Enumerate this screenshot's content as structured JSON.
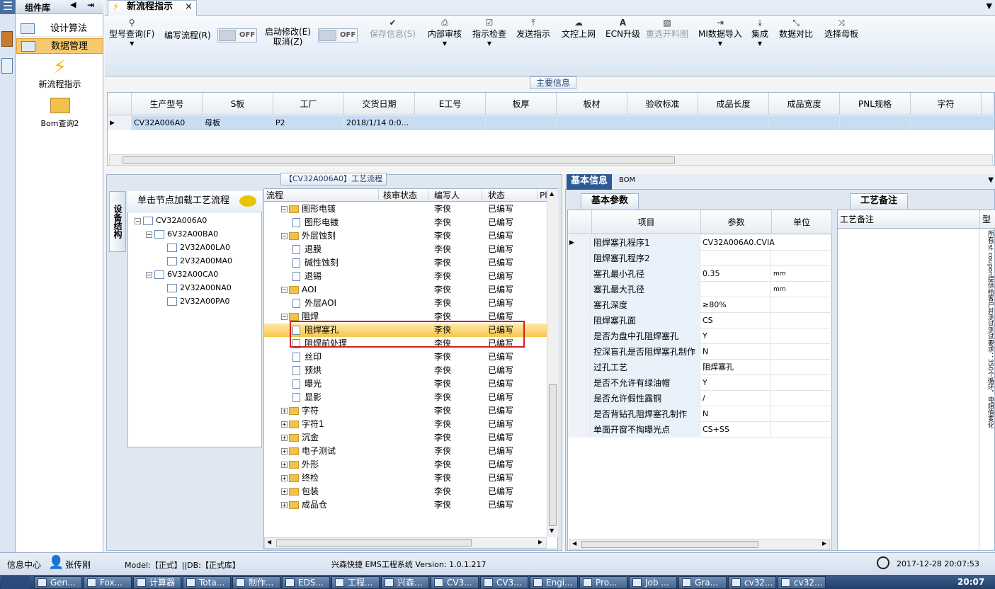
{
  "sidebar": {
    "title": "组件库",
    "items": [
      {
        "label": "设计算法"
      },
      {
        "label": "数据管理",
        "selected": true
      }
    ],
    "tools": [
      {
        "label": "新流程指示",
        "icon": "lightning-icon"
      },
      {
        "label": "Bom查询2",
        "icon": "folder-open-icon"
      }
    ]
  },
  "tab": {
    "title": "新流程指示",
    "close": "×"
  },
  "ribbon": {
    "buttons": [
      {
        "label": "型号查询(F)",
        "icon": "search-icon",
        "dropdown": true
      },
      {
        "label": "编写流程(R)"
      },
      {
        "label": "启动修改(E)"
      },
      {
        "label": "取消(Z)"
      },
      {
        "label": "保存信息(S)",
        "icon": "check-icon",
        "disabled": true
      },
      {
        "label": "内部审核",
        "icon": "print-icon",
        "dropdown": true
      },
      {
        "label": "指示检查",
        "icon": "checkbox-icon",
        "dropdown": true
      },
      {
        "label": "发送指示",
        "icon": "upload-icon"
      },
      {
        "label": "文控上网",
        "icon": "cloud-upload-icon"
      },
      {
        "label": "ECN升级",
        "icon": "ecn-icon"
      },
      {
        "label": "重选开料图",
        "icon": "image-icon",
        "disabled": true
      },
      {
        "label": "MI数据导入",
        "icon": "import-icon",
        "dropdown": true
      },
      {
        "label": "集成",
        "icon": "download-icon",
        "dropdown": true
      },
      {
        "label": "数据对比",
        "icon": "compare-icon"
      },
      {
        "label": "选择母板",
        "icon": "shuffle-icon"
      }
    ],
    "toggles": [
      {
        "value": "OFF"
      },
      {
        "value": "OFF"
      }
    ]
  },
  "main_info": {
    "title": "主要信息",
    "columns": [
      "生产型号",
      "S板",
      "工厂",
      "交货日期",
      "E工号",
      "板厚",
      "板材",
      "验收标准",
      "成品长度",
      "成品宽度",
      "PNL规格",
      "字符"
    ],
    "rows": [
      [
        "CV32A006A0",
        "母板",
        "P2",
        "2018/1/14 0:0...",
        "",
        "",
        "",
        "",
        "",
        "",
        "",
        ""
      ]
    ]
  },
  "process": {
    "title": "【CV32A006A0】工艺流程",
    "vertical_tab": "设备结构",
    "tree_header": "单击节点加载工艺流程",
    "tree": [
      {
        "label": "CV32A006A0",
        "level": 0
      },
      {
        "label": "6V32A00BA0",
        "level": 1
      },
      {
        "label": "2V32A00LA0",
        "level": 2
      },
      {
        "label": "2V32A00MA0",
        "level": 2
      },
      {
        "label": "6V32A00CA0",
        "level": 1
      },
      {
        "label": "2V32A00NA0",
        "level": 2
      },
      {
        "label": "2V32A00PA0",
        "level": 2
      }
    ],
    "columns": [
      "流程",
      "核审状态",
      "编写人",
      "状态",
      "Pl"
    ],
    "rows": [
      {
        "name": "图形电镀",
        "kind": "folder",
        "author": "李侠",
        "status": "已编写"
      },
      {
        "name": "图形电镀",
        "kind": "doc",
        "author": "李侠",
        "status": "已编写"
      },
      {
        "name": "外层蚀刻",
        "kind": "folder",
        "author": "李侠",
        "status": "已编写"
      },
      {
        "name": "退膜",
        "kind": "doc",
        "author": "李侠",
        "status": "已编写"
      },
      {
        "name": "碱性蚀刻",
        "kind": "doc",
        "author": "李侠",
        "status": "已编写"
      },
      {
        "name": "退锡",
        "kind": "doc",
        "author": "李侠",
        "status": "已编写"
      },
      {
        "name": "AOI",
        "kind": "folder",
        "author": "李侠",
        "status": "已编写"
      },
      {
        "name": "外层AOI",
        "kind": "doc",
        "author": "李侠",
        "status": "已编写"
      },
      {
        "name": "阻焊",
        "kind": "folder",
        "author": "李侠",
        "status": "已编写"
      },
      {
        "name": "阻焊塞孔",
        "kind": "doc",
        "author": "李侠",
        "status": "已编写",
        "selected": true
      },
      {
        "name": "阻焊前处理",
        "kind": "doc",
        "author": "李侠",
        "status": "已编写"
      },
      {
        "name": "丝印",
        "kind": "doc",
        "author": "李侠",
        "status": "已编写"
      },
      {
        "name": "预烘",
        "kind": "doc",
        "author": "李侠",
        "status": "已编写"
      },
      {
        "name": "曝光",
        "kind": "doc",
        "author": "李侠",
        "status": "已编写"
      },
      {
        "name": "显影",
        "kind": "doc",
        "author": "李侠",
        "status": "已编写"
      },
      {
        "name": "字符",
        "kind": "folderc",
        "author": "李侠",
        "status": "已编写"
      },
      {
        "name": "字符1",
        "kind": "folderc",
        "author": "李侠",
        "status": "已编写"
      },
      {
        "name": "沉金",
        "kind": "folderc",
        "author": "李侠",
        "status": "已编写"
      },
      {
        "name": "电子测试",
        "kind": "folderc",
        "author": "李侠",
        "status": "已编写"
      },
      {
        "name": "外形",
        "kind": "folderc",
        "author": "李侠",
        "status": "已编写"
      },
      {
        "name": "终检",
        "kind": "folderc",
        "author": "李侠",
        "status": "已编写"
      },
      {
        "name": "包装",
        "kind": "folderc",
        "author": "李侠",
        "status": "已编写"
      },
      {
        "name": "成品仓",
        "kind": "folderc",
        "author": "李侠",
        "status": "已编写"
      }
    ]
  },
  "right": {
    "tabs": [
      "基本信息",
      "BOM"
    ],
    "section": "基本参数",
    "columns": [
      "项目",
      "参数",
      "单位"
    ],
    "rows": [
      [
        "阻焊塞孔程序1",
        "CV32A006A0.CVIA",
        ""
      ],
      [
        "阻焊塞孔程序2",
        "",
        ""
      ],
      [
        "塞孔最小孔径",
        "0.35",
        "mm"
      ],
      [
        "塞孔最大孔径",
        "",
        "mm"
      ],
      [
        "塞孔深度",
        "≥80%",
        ""
      ],
      [
        "阻焊塞孔面",
        "CS",
        ""
      ],
      [
        "是否为盘中孔阻焊塞孔",
        "Y",
        ""
      ],
      [
        "控深盲孔是否阻焊塞孔制作",
        "N",
        ""
      ],
      [
        "过孔工艺",
        "阻焊塞孔",
        ""
      ],
      [
        "是否不允许有绿油帽",
        "Y",
        ""
      ],
      [
        "是否允许假性露铜",
        "/",
        ""
      ],
      [
        "是否背钻孔阻焊塞孔制作",
        "N",
        ""
      ],
      [
        "单面开窗不掏曝光点",
        "CS+SS",
        ""
      ]
    ],
    "notes_tab": "工艺备注",
    "notes_label": "工艺备注",
    "notes_col2": "型",
    "notes_vertical": "所有ist coupon提供给客户并测试测试要求：350个循环，电阻值变化"
  },
  "status": {
    "info_center": "信息中心",
    "user": "张传刚",
    "model": "Model:【正式】||DB:【正式库】",
    "system": "兴森快捷 EMS工程系统 Version: 1.0.1.217",
    "datetime": "2017-12-28 20:07:53"
  },
  "taskbar": {
    "items": [
      "Gen...",
      "Fox...",
      "计算器",
      "Tota...",
      "制作...",
      "EDS...",
      "工程...",
      "兴森...",
      "CV3...",
      "CV3...",
      "Engi...",
      "Pro...",
      "Job ...",
      "Gra...",
      "cv32...",
      "cv32..."
    ],
    "clock": "20:07"
  }
}
